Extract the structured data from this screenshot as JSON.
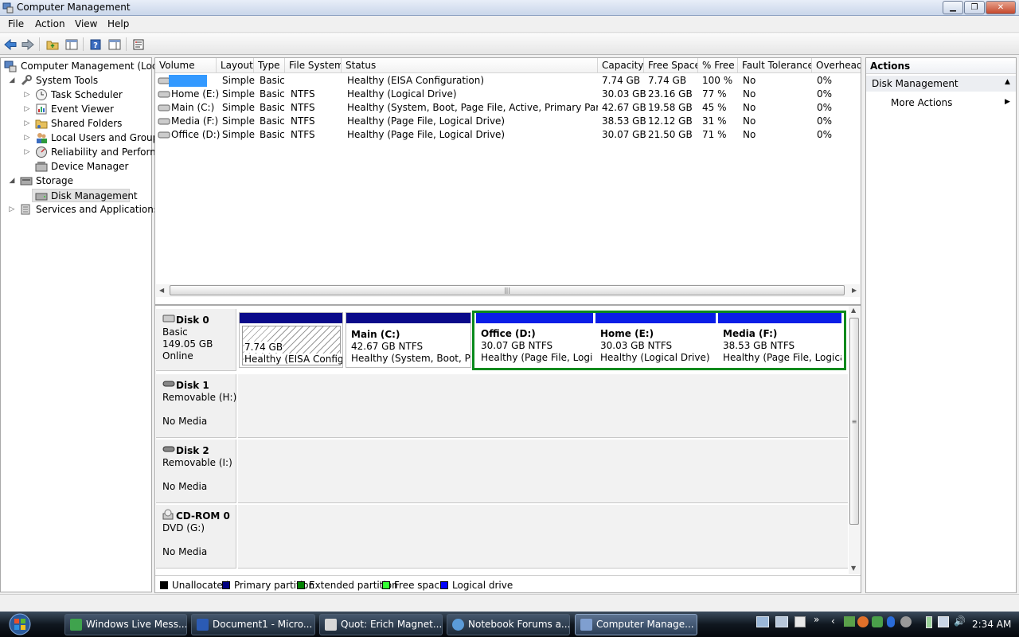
{
  "window": {
    "title": "Computer Management"
  },
  "menu": [
    "File",
    "Action",
    "View",
    "Help"
  ],
  "toolbar": {
    "icons": [
      "back-arrow-icon",
      "forward-arrow-icon",
      "up-folder-icon",
      "show-hide-tree-icon",
      "help-icon",
      "show-hide-action-pane-icon",
      "properties-icon"
    ]
  },
  "tree": {
    "root": "Computer Management (Local",
    "system_tools": "System Tools",
    "task_scheduler": "Task Scheduler",
    "event_viewer": "Event Viewer",
    "shared_folders": "Shared Folders",
    "local_users": "Local Users and Groups",
    "reliability": "Reliability and Performa",
    "device_manager": "Device Manager",
    "storage": "Storage",
    "disk_management": "Disk Management",
    "services": "Services and Applications"
  },
  "volumes": {
    "columns": [
      "Volume",
      "Layout",
      "Type",
      "File System",
      "Status",
      "Capacity",
      "Free Space",
      "% Free",
      "Fault Tolerance",
      "Overhead"
    ],
    "rows": [
      {
        "volume": "",
        "layout": "Simple",
        "type": "Basic",
        "fs": "",
        "status": "Healthy (EISA Configuration)",
        "capacity": "7.74 GB",
        "free": "7.74 GB",
        "pct": "100 %",
        "fault": "No",
        "overhead": "0%"
      },
      {
        "volume": "Home (E:)",
        "layout": "Simple",
        "type": "Basic",
        "fs": "NTFS",
        "status": "Healthy (Logical Drive)",
        "capacity": "30.03 GB",
        "free": "23.16 GB",
        "pct": "77 %",
        "fault": "No",
        "overhead": "0%"
      },
      {
        "volume": "Main (C:)",
        "layout": "Simple",
        "type": "Basic",
        "fs": "NTFS",
        "status": "Healthy (System, Boot, Page File, Active, Primary Partition)",
        "capacity": "42.67 GB",
        "free": "19.58 GB",
        "pct": "45 %",
        "fault": "No",
        "overhead": "0%"
      },
      {
        "volume": "Media (F:)",
        "layout": "Simple",
        "type": "Basic",
        "fs": "NTFS",
        "status": "Healthy (Page File, Logical Drive)",
        "capacity": "38.53 GB",
        "free": "12.12 GB",
        "pct": "31 %",
        "fault": "No",
        "overhead": "0%"
      },
      {
        "volume": "Office (D:)",
        "layout": "Simple",
        "type": "Basic",
        "fs": "NTFS",
        "status": "Healthy (Page File, Logical Drive)",
        "capacity": "30.07 GB",
        "free": "21.50 GB",
        "pct": "71 %",
        "fault": "No",
        "overhead": "0%"
      }
    ]
  },
  "disks": [
    {
      "name": "Disk 0",
      "line1": "Basic",
      "line2": "149.05 GB",
      "line3": "Online"
    },
    {
      "name": "Disk 1",
      "line1": "Removable (H:)",
      "line2": "",
      "line3": "No Media"
    },
    {
      "name": "Disk 2",
      "line1": "Removable (I:)",
      "line2": "",
      "line3": "No Media"
    },
    {
      "name": "CD-ROM 0",
      "line1": "DVD (G:)",
      "line2": "",
      "line3": "No Media"
    }
  ],
  "partitions": [
    {
      "title": "",
      "size": "7.74 GB",
      "status": "Healthy (EISA Configu"
    },
    {
      "title": "Main  (C:)",
      "size": "42.67 GB NTFS",
      "status": "Healthy (System, Boot, Pag"
    },
    {
      "title": "Office  (D:)",
      "size": "30.07 GB NTFS",
      "status": "Healthy (Page File, Logica"
    },
    {
      "title": "Home  (E:)",
      "size": "30.03 GB NTFS",
      "status": "Healthy (Logical Drive)"
    },
    {
      "title": "Media  (F:)",
      "size": "38.53 GB NTFS",
      "status": "Healthy (Page File, Logical"
    }
  ],
  "legend": [
    {
      "label": "Unallocated",
      "color": "#000000"
    },
    {
      "label": "Primary partition",
      "color": "#000080"
    },
    {
      "label": "Extended partition",
      "color": "#008000"
    },
    {
      "label": "Free space",
      "color": "#33ff33"
    },
    {
      "label": "Logical drive",
      "color": "#0000ff"
    }
  ],
  "actions": {
    "header": "Actions",
    "section": "Disk Management",
    "more": "More Actions"
  },
  "taskbar": {
    "tasks": [
      "Windows Live Mess...",
      "Document1 - Micro...",
      "Quot: Erich  Magnet...",
      "Notebook Forums a...",
      "Computer Manage..."
    ],
    "clock": "2:34 AM"
  }
}
